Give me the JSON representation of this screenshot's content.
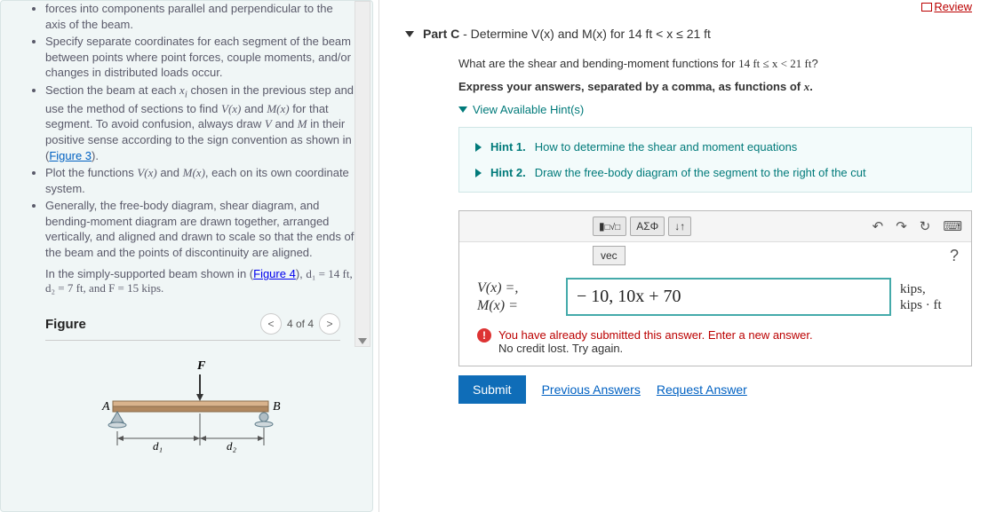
{
  "review": "Review",
  "instructions": {
    "li1": "forces into components parallel and perpendicular to the axis of the beam.",
    "li2a": "Specify separate coordinates for each segment of the beam between points where point forces, couple moments, and/or changes in distributed loads occur.",
    "li3a": "Section the beam at each ",
    "li3b": " chosen in the previous step and use the method of sections to find ",
    "li3c": " and ",
    "li3d": " for that segment. To avoid confusion, always draw ",
    "li3e": " and ",
    "li3f": " in their positive sense according to the sign convention as shown in (",
    "fig3": "Figure 3",
    "li3g": ").",
    "li4a": "Plot the functions ",
    "li4b": " and ",
    "li4c": ", each on its own coordinate system.",
    "li5": "Generally, the free-body diagram, shear diagram, and bending-moment diagram are drawn together, arranged vertically, and aligned and drawn to scale so that the ends of the beam and the points of discontinuity are aligned."
  },
  "given_a": "In the simply-supported beam shown in (",
  "fig4": "Figure 4",
  "given_b": "), ",
  "given_vals": "d₁ = 14 ft, d₂ = 7 ft, and F = 15 kips.",
  "figure": {
    "title": "Figure",
    "nav": "4 of 4"
  },
  "part": {
    "label": "Part C",
    "desc": " - Determine V(x) and M(x) for 14 ft < x ≤ 21 ft"
  },
  "q1a": "What are the shear and bending-moment functions for ",
  "q1b": "14 ft ≤ x < 21 ft",
  "q1c": "?",
  "q2a": "Express your answers, separated by a comma, as functions of ",
  "q2b": "x",
  "q2c": ".",
  "view_hints": "View Available Hint(s)",
  "hints": {
    "h1_label": "Hint 1.",
    "h1_text": "How to determine the shear and moment equations",
    "h2_label": "Hint 2.",
    "h2_text": "Draw the free-body diagram of the segment to the right of the cut"
  },
  "toolbar": {
    "frac": "□√□",
    "greek": "ΑΣΦ",
    "arrows": "↓↑",
    "undo": "↶",
    "redo": "↷",
    "reset": "↻",
    "keyboard": "⌨",
    "help": "?",
    "vec": "vec"
  },
  "answer": {
    "label1": "V(x) =,",
    "label2": "M(x) =",
    "value": "− 10, 10x + 70",
    "units1": "kips,",
    "units2": "kips · ft"
  },
  "feedback": {
    "line1": "You have already submitted this answer. Enter a new answer.",
    "line2": "No credit lost. Try again."
  },
  "submit": "Submit",
  "prev_ans": "Previous Answers",
  "req_ans": "Request Answer",
  "fig_labels": {
    "A": "A",
    "B": "B",
    "F": "F",
    "d1": "d₁",
    "d2": "d₂"
  }
}
